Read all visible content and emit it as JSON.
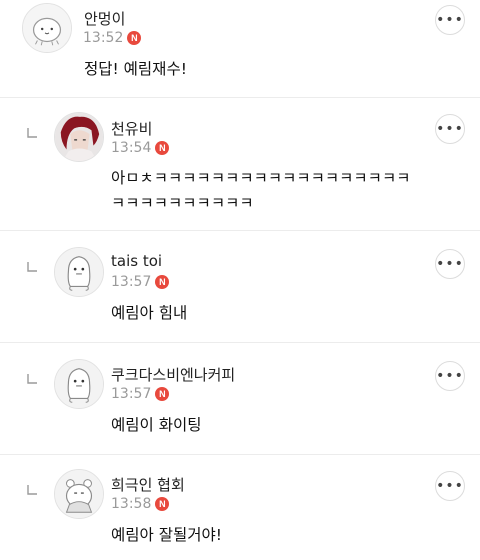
{
  "comments": [
    {
      "nickname": "안멍이",
      "time": "13:52",
      "badge": "N",
      "text": "정답! 예림재수!",
      "more": "•••",
      "reply": false
    },
    {
      "nickname": "천유비",
      "time": "13:54",
      "badge": "N",
      "text": "아ㅁㅊㅋㅋㅋㅋㅋㅋㅋㅋㅋㅋㅋㅋㅋㅋㅋㅋㅋㅋ",
      "text2": "ㅋㅋㅋㅋㅋㅋㅋㅋㅋㅋ",
      "more": "•••",
      "reply": true
    },
    {
      "nickname": "tais toi",
      "time": "13:57",
      "badge": "N",
      "text": "예림아 힘내",
      "more": "•••",
      "reply": true
    },
    {
      "nickname": "쿠크다스비엔나커피",
      "time": "13:57",
      "badge": "N",
      "text": "예림이 화이팅",
      "more": "•••",
      "reply": true
    },
    {
      "nickname": "희극인 협회",
      "time": "13:58",
      "badge": "N",
      "text": "예림아 잘될거야!",
      "more": "•••",
      "reply": true
    }
  ]
}
